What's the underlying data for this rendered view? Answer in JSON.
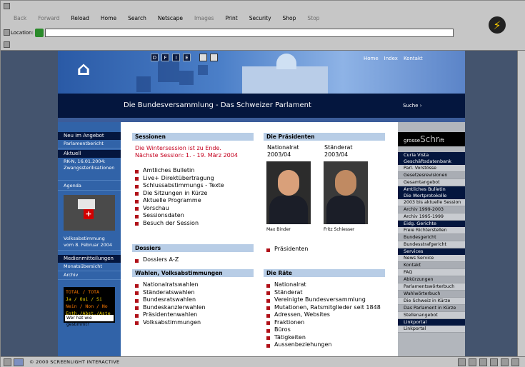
{
  "browser": {
    "buttons": [
      "Back",
      "Forward",
      "Reload",
      "Home",
      "Search",
      "Netscape",
      "Images",
      "Print",
      "Security",
      "Shop",
      "Stop"
    ],
    "location_label": "Location:",
    "location_value": "",
    "status": "© 2000 SCREENLIGHT INTERACTIVE"
  },
  "banner": {
    "languages": [
      "D",
      "F",
      "I",
      "E"
    ],
    "toplinks": [
      "Home",
      "Index",
      "Kontakt"
    ],
    "title": "Die Bundesversammlung - Das Schweizer Parlament",
    "search": "Suche ›"
  },
  "left": {
    "items": [
      {
        "label": "Neu im Angebot",
        "head": true
      },
      {
        "label": "Parlamentbericht"
      },
      {
        "label": "Aktuell",
        "head": true
      },
      {
        "label": "RK-N, 16.01.2004: Zwangssterilisationen"
      },
      {
        "label": "Agenda"
      },
      {
        "label": "Volksabstimmung vom 8. Februar 2004"
      },
      {
        "label": "Medienmitteilungen",
        "head": true
      },
      {
        "label": "Monatsübersicht"
      },
      {
        "label": "Archiv"
      }
    ],
    "led_lines": [
      "TOTAL / TOTA",
      "Ja / Oui / Si",
      "Nein / Non / No",
      "Enth./Abst./Aste"
    ],
    "led_button": "Wer hat wie gestimmt?"
  },
  "main": {
    "sessionen": {
      "title": "Sessionen",
      "alert1": "Die Wintersession ist zu Ende.",
      "alert2": "Nächste Session: 1. - 19. März 2004",
      "items": [
        "Amtliches Bulletin",
        "Live+ Direktübertragung",
        "Schlussabstimmungs - Texte",
        "Die Sitzungen in Kürze",
        "Aktuelle Programme",
        "Vorschau",
        "Sessionsdaten",
        "Besuch der Session"
      ]
    },
    "praesidenten": {
      "title": "Die Präsidenten",
      "nr_label": "Nationalrat",
      "nr_year": "2003/04",
      "sr_label": "Ständerat",
      "sr_year": "2003/04",
      "nr_name": "Max Binder",
      "sr_name": "Fritz Schiesser",
      "link": "Präsidenten"
    },
    "dossiers": {
      "title": "Dossiers",
      "items": [
        "Dossiers A-Z"
      ]
    },
    "wahlen": {
      "title": "Wahlen, Volksabstimmungen",
      "items": [
        "Nationalratswahlen",
        "Ständeratswahlen",
        "Bundesratswahlen",
        "Bundeskanzlerwahlen",
        "Präsidentenwahlen",
        "Volksabstimmungen"
      ]
    },
    "raete": {
      "title": "Die Räte",
      "items": [
        "Nationalrat",
        "Ständerat",
        "Vereinigte Bundesversammlung",
        "Mutationen, Ratsmitglieder seit 1848",
        "Adressen, Websites",
        "Fraktionen",
        "Büros",
        "Tätigkeiten",
        "Aussenbeziehungen"
      ]
    }
  },
  "right": {
    "gross_label": "grosse",
    "gross_big": "Schr",
    "gross_tail": "ift",
    "groups": [
      {
        "head": [
          "Curia Vista",
          "Geschäftsdatenbank"
        ],
        "items": [
          "Parl. Vorstösse",
          "Gesetzesrevisionen",
          "Gesamtangebot"
        ]
      },
      {
        "head": [
          "Amtliches Bulletin",
          "Die Wortprotokolle"
        ],
        "items": [
          "2003 bis aktuelle Session",
          "Archiv 1999-2003",
          "Archiv 1995-1999"
        ]
      },
      {
        "head": [
          "Eidg. Gerichte"
        ],
        "items": [
          "Freie Richterstellen",
          "Bundesgericht",
          "Bundesstrafgericht"
        ]
      },
      {
        "head": [
          "Services"
        ],
        "items": [
          "News Service",
          "Kontakt",
          "FAQ",
          "Abkürzungen",
          "Parlamentswörterbuch",
          "Wahlwörterbuch",
          "Die Schweiz in Kürze",
          "Das Parlament in Kürze",
          "Stellenangebot"
        ]
      },
      {
        "head": [
          "Linkportal"
        ],
        "items": [
          "Linkportal"
        ]
      }
    ]
  }
}
